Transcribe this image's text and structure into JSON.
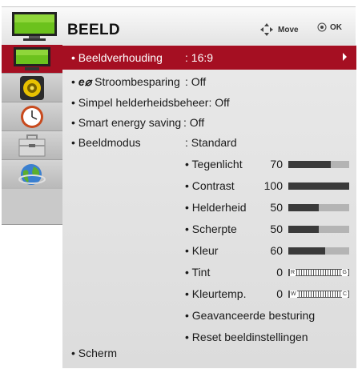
{
  "header": {
    "title": "BEELD",
    "move_label": "Move",
    "ok_label": "OK"
  },
  "sidebar": {
    "items": [
      {
        "name": "picture",
        "icon": "tv-icon",
        "active": true
      },
      {
        "name": "audio",
        "icon": "speaker-icon",
        "active": false
      },
      {
        "name": "time",
        "icon": "clock-icon",
        "active": false
      },
      {
        "name": "setup",
        "icon": "toolbox-icon",
        "active": false
      },
      {
        "name": "network",
        "icon": "globe-icon",
        "active": false
      }
    ]
  },
  "menu": {
    "aspect": {
      "label": "• Beeldverhouding",
      "value": ": 16:9"
    },
    "power_saving": {
      "bullet": "•",
      "eco_symbol": "e⌀",
      "label": "Stroombesparing",
      "value": ": Off"
    },
    "simple_brightness": {
      "label": "• Simpel helderheidsbeheer: Off"
    },
    "smart_energy": {
      "label": "• Smart energy saving",
      "value": ": Off"
    },
    "picture_mode": {
      "label": "• Beeldmodus",
      "value": ": Standard"
    },
    "settings": [
      {
        "label": "• Tegenlicht",
        "value": "70",
        "level": 70
      },
      {
        "label": "• Contrast",
        "value": "100",
        "level": 100
      },
      {
        "label": "• Helderheid",
        "value": "50",
        "level": 50
      },
      {
        "label": "• Scherpte",
        "value": "50",
        "level": 50
      },
      {
        "label": "• Kleur",
        "value": "60",
        "level": 60
      }
    ],
    "tint": {
      "label": "• Tint",
      "value": "0",
      "left": "R",
      "right": "G"
    },
    "color_temp": {
      "label": "• Kleurtemp.",
      "value": "0",
      "left": "W",
      "right": "C"
    },
    "advanced": {
      "label": "• Geavanceerde besturing"
    },
    "reset": {
      "label": "• Reset beeldinstellingen"
    },
    "screen": {
      "label": "• Scherm"
    }
  },
  "colors": {
    "accent": "#a50f22",
    "panel": "#e3e3e3",
    "sidebar": "#c9c9c9"
  }
}
